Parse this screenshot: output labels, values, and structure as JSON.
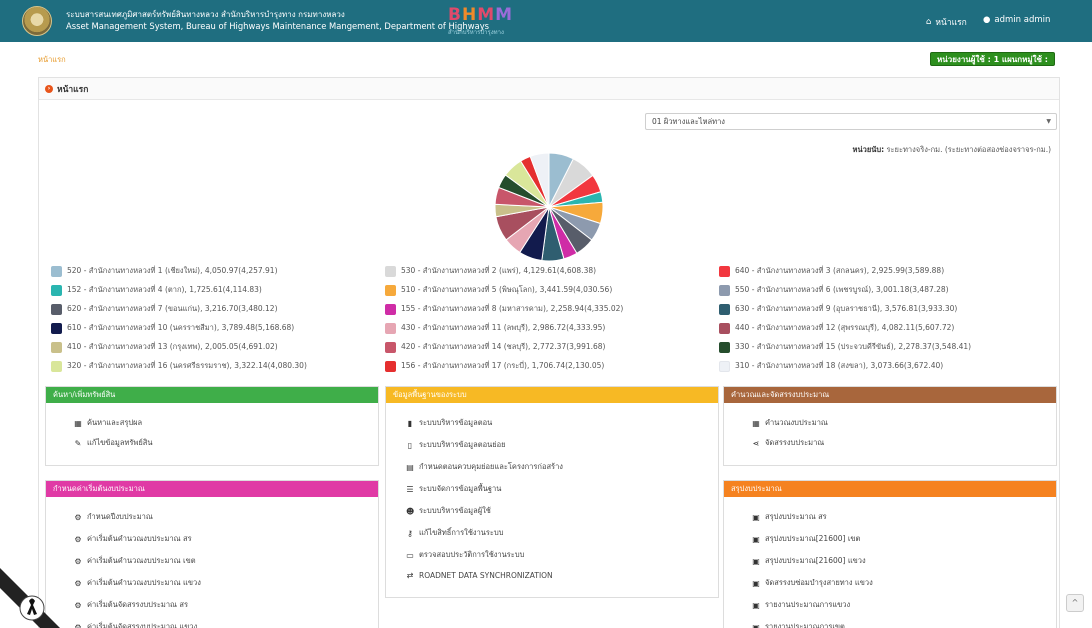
{
  "header": {
    "title_th": "ระบบสารสนเทศภูมิศาสตร์ทรัพย์สินทางหลวง สำนักบริหารบำรุงทาง กรมทางหลวง",
    "title_en": "Asset Management System, Bureau of Highways Maintenance Mangement, Department of Highways",
    "brand": "BHMM",
    "brand_sub": "สำนักบริหารบำรุงทาง",
    "nav_home": "หน้าแรก",
    "nav_user": "admin admin",
    "colors": {
      "header_bg": "#1f6e80",
      "accent": "#e8541a"
    }
  },
  "breadcrumb": "หน้าแรก",
  "unit_badge": "หน่วยงานผู้ใช้ : 1 แผนกหมู่ใช้ :",
  "panel_title": "หน้าแรก",
  "select_value": "01 ผิวทางและไหล่ทาง",
  "unit_note_label": "หน่วยนับ:",
  "unit_note_text": "ระยะทางจริง-กม. (ระยะทางต่อสองช่องจราจร-กม.)",
  "chart_data": {
    "type": "pie",
    "slices": [
      {
        "label": "520 - สำนักงานทางหลวงที่ 1 (เชียงใหม่), 4,050.97(4,257.91)",
        "value": 4050.97,
        "color": "#9bbdd0"
      },
      {
        "label": "530 - สำนักงานทางหลวงที่ 2 (แพร่), 4,129.61(4,608.38)",
        "value": 4129.61,
        "color": "#d9d9d9"
      },
      {
        "label": "640 - สำนักงานทางหลวงที่ 3 (สกลนคร), 2,925.99(3,589.88)",
        "value": 2925.99,
        "color": "#f2373f"
      },
      {
        "label": "152 - สำนักงานทางหลวงที่ 4 (ตาก), 1,725.61(4,114.83)",
        "value": 1725.61,
        "color": "#2ab5b0"
      },
      {
        "label": "510 - สำนักงานทางหลวงที่ 5 (พิษณุโลก), 3,441.59(4,030.56)",
        "value": 3441.59,
        "color": "#f6a93b"
      },
      {
        "label": "550 - สำนักงานทางหลวงที่ 6 (เพชรบูรณ์), 3,001.18(3,487.28)",
        "value": 3001.18,
        "color": "#8d9aae"
      },
      {
        "label": "620 - สำนักงานทางหลวงที่ 7 (ขอนแก่น), 3,216.70(3,480.12)",
        "value": 3216.7,
        "color": "#585d6a"
      },
      {
        "label": "155 - สำนักงานทางหลวงที่ 8 (มหาสารคาม), 2,258.94(4,335.02)",
        "value": 2258.94,
        "color": "#cf2ca6"
      },
      {
        "label": "630 - สำนักงานทางหลวงที่ 9 (อุบลราชธานี), 3,576.81(3,933.30)",
        "value": 3576.81,
        "color": "#2f5e70"
      },
      {
        "label": "610 - สำนักงานทางหลวงที่ 10 (นครราชสีมา), 3,789.48(5,168.68)",
        "value": 3789.48,
        "color": "#121b4d"
      },
      {
        "label": "430 - สำนักงานทางหลวงที่ 11 (ลพบุรี), 2,986.72(4,333.95)",
        "value": 2986.72,
        "color": "#e6a6b3"
      },
      {
        "label": "440 - สำนักงานทางหลวงที่ 12 (สุพรรณบุรี), 4,082.11(5,607.72)",
        "value": 4082.11,
        "color": "#a84f5f"
      },
      {
        "label": "410 - สำนักงานทางหลวงที่ 13 (กรุงเทพ), 2,005.05(4,691.02)",
        "value": 2005.05,
        "color": "#c9c08a"
      },
      {
        "label": "420 - สำนักงานทางหลวงที่ 14 (ชลบุรี), 2,772.37(3,991.68)",
        "value": 2772.37,
        "color": "#c8566a"
      },
      {
        "label": "330 - สำนักงานทางหลวงที่ 15 (ประจวบคีรีขันธ์), 2,278.37(3,548.41)",
        "value": 2278.37,
        "color": "#254d2d"
      },
      {
        "label": "320 - สำนักงานทางหลวงที่ 16 (นครศรีธรรมราช), 3,322.14(4,080.30)",
        "value": 3322.14,
        "color": "#d9e69a"
      },
      {
        "label": "156 - สำนักงานทางหลวงที่ 17 (กระบี่), 1,706.74(2,130.05)",
        "value": 1706.74,
        "color": "#e52f2f"
      },
      {
        "label": "310 - สำนักงานทางหลวงที่ 18 (สงขลา), 3,073.66(3,672.40)",
        "value": 3073.66,
        "color": "#eef1f6"
      }
    ]
  },
  "cards": {
    "search": {
      "title": "ค้นหา/เพิ่มทรัพย์สิน",
      "color": "#3fae49",
      "items": [
        {
          "label": "ค้นหาและสรุปผล",
          "icon": "table-icon"
        },
        {
          "label": "แก้ไขข้อมูลทรัพย์สิน",
          "icon": "edit-icon"
        }
      ]
    },
    "basedata": {
      "title": "ข้อมูลพื้นฐานของระบบ",
      "color": "#f7b924",
      "items": [
        {
          "label": "ระบบบริหารข้อมูลตอน",
          "icon": "bookmark-icon"
        },
        {
          "label": "ระบบบริหารข้อมูลตอนย่อย",
          "icon": "bookmark-outline-icon"
        },
        {
          "label": "กำหนดตอนควบคุมย่อยและโครงการก่อสร้าง",
          "icon": "grid-icon"
        },
        {
          "label": "ระบบจัดการข้อมูลพื้นฐาน",
          "icon": "list-icon"
        },
        {
          "label": "ระบบบริหารข้อมูลผู้ใช้",
          "icon": "users-icon"
        },
        {
          "label": "แก้ไขสิทธิ์การใช้งานระบบ",
          "icon": "key-icon"
        },
        {
          "label": "ตรวจสอบประวัติการใช้งานระบบ",
          "icon": "laptop-icon"
        },
        {
          "label": "ROADNET DATA SYNCHRONIZATION",
          "icon": "sync-icon"
        }
      ]
    },
    "budget": {
      "title": "คำนวณและจัดสรรงบประมาณ",
      "color": "#a8663c",
      "items": [
        {
          "label": "คำนวณงบประมาณ",
          "icon": "calculator-icon"
        },
        {
          "label": "จัดสรรงบประมาณ",
          "icon": "share-icon"
        }
      ]
    },
    "setup": {
      "title": "กำหนดค่าเริ่มต้นงบประมาณ",
      "color": "#e03aa5",
      "items": [
        {
          "label": "กำหนดปีงบประมาณ",
          "icon": "gear-icon"
        },
        {
          "label": "ค่าเริ่มต้นคำนวณงบประมาณ สร",
          "icon": "gear-icon"
        },
        {
          "label": "ค่าเริ่มต้นคำนวณงบประมาณ เขต",
          "icon": "gear-icon"
        },
        {
          "label": "ค่าเริ่มต้นคำนวณงบประมาณ แขวง",
          "icon": "gear-icon"
        },
        {
          "label": "ค่าเริ่มต้นจัดสรรงบประมาณ สร",
          "icon": "gear-icon"
        },
        {
          "label": "ค่าเริ่มต้นจัดสรรงบประมาณ แขวง",
          "icon": "gear-icon"
        }
      ]
    },
    "summary": {
      "title": "สรุปงบประมาณ",
      "color": "#f58220",
      "items": [
        {
          "label": "สรุปงบประมาณ สร",
          "icon": "calendar-icon"
        },
        {
          "label": "สรุปงบประมาณ[21600] เขต",
          "icon": "calendar-icon"
        },
        {
          "label": "สรุปงบประมาณ[21600] แขวง",
          "icon": "calendar-icon"
        },
        {
          "label": "จัดสรรงบซ่อมบำรุงสายทาง แขวง",
          "icon": "calendar-icon"
        },
        {
          "label": "รายงานประมาณการแขวง",
          "icon": "calendar-icon"
        },
        {
          "label": "รายงานประมาณการเขต",
          "icon": "calendar-icon"
        }
      ]
    }
  }
}
